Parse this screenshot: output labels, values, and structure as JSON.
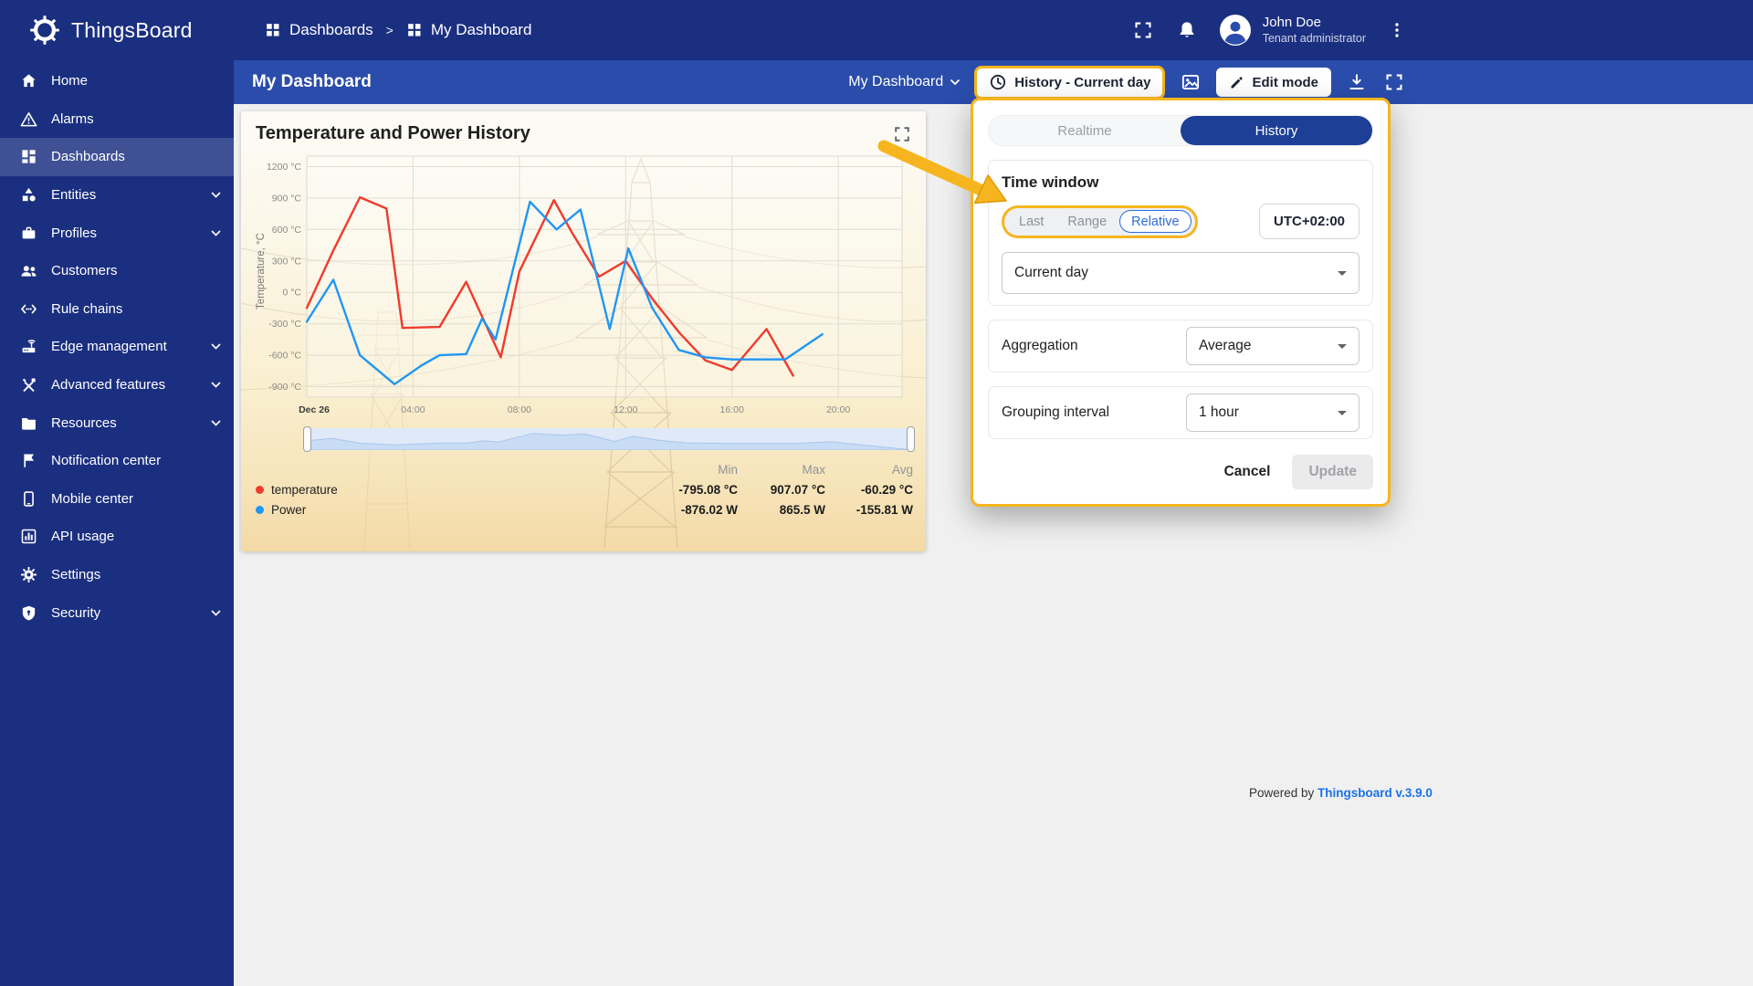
{
  "colors": {
    "header_blue": "#1b2f80",
    "toolbar_blue": "#2a4cab",
    "highlight_gold": "#f6b51e",
    "temperature_series": "#ef3b2d",
    "power_series": "#2196f3",
    "active_tab_blue": "#1d3f96",
    "link_blue": "#1a73e8"
  },
  "header": {
    "brand": "ThingsBoard",
    "breadcrumb": {
      "root": "Dashboards",
      "separator": ">",
      "current": "My Dashboard"
    },
    "user": {
      "name": "John Doe",
      "role": "Tenant administrator"
    }
  },
  "icons": {
    "logo": "gear-icon",
    "header": [
      "fullscreen-icon",
      "notifications-bell-icon",
      "avatar-icon",
      "kebab-menu-icon"
    ],
    "toolbar": [
      "chevron-down-icon",
      "clock-icon",
      "image-icon",
      "pencil-icon",
      "download-icon",
      "fullscreen-icon"
    ],
    "widget": [
      "expand-icon"
    ]
  },
  "sidebar": {
    "items": [
      {
        "label": "Home",
        "icon": "home-icon",
        "active": false,
        "expandable": false
      },
      {
        "label": "Alarms",
        "icon": "alarms-icon",
        "active": false,
        "expandable": false
      },
      {
        "label": "Dashboards",
        "icon": "dashboards-icon",
        "active": true,
        "expandable": false
      },
      {
        "label": "Entities",
        "icon": "entities-icon",
        "active": false,
        "expandable": true
      },
      {
        "label": "Profiles",
        "icon": "profiles-icon",
        "active": false,
        "expandable": true
      },
      {
        "label": "Customers",
        "icon": "customers-icon",
        "active": false,
        "expandable": false
      },
      {
        "label": "Rule chains",
        "icon": "rule-chains-icon",
        "active": false,
        "expandable": false
      },
      {
        "label": "Edge management",
        "icon": "edge-icon",
        "active": false,
        "expandable": true
      },
      {
        "label": "Advanced features",
        "icon": "advanced-icon",
        "active": false,
        "expandable": true
      },
      {
        "label": "Resources",
        "icon": "resources-icon",
        "active": false,
        "expandable": true
      },
      {
        "label": "Notification center",
        "icon": "notification-icon",
        "active": false,
        "expandable": false
      },
      {
        "label": "Mobile center",
        "icon": "mobile-icon",
        "active": false,
        "expandable": false
      },
      {
        "label": "API usage",
        "icon": "api-icon",
        "active": false,
        "expandable": false
      },
      {
        "label": "Settings",
        "icon": "settings-icon",
        "active": false,
        "expandable": false
      },
      {
        "label": "Security",
        "icon": "security-icon",
        "active": false,
        "expandable": true
      }
    ]
  },
  "toolbar": {
    "title": "My Dashboard",
    "dashboard_select": "My Dashboard",
    "timewindow_button": "History - Current day",
    "edit_button": "Edit mode"
  },
  "widget": {
    "title": "Temperature and Power History",
    "legend": {
      "headers": [
        "Min",
        "Max",
        "Avg"
      ],
      "rows": [
        {
          "name": "temperature",
          "color": "#ef3b2d",
          "min": "-795.08 °C",
          "max": "907.07 °C",
          "avg": "-60.29 °C"
        },
        {
          "name": "Power",
          "color": "#2196f3",
          "min": "-876.02 W",
          "max": "865.5 W",
          "avg": "-155.81 W"
        }
      ]
    }
  },
  "chart_data": {
    "type": "line",
    "title": "Temperature and Power History",
    "xlabel": "",
    "ylabel": "Temperature, °C",
    "ylim": [
      -1000,
      1300
    ],
    "y_ticks": [
      1200,
      900,
      600,
      300,
      0,
      -300,
      -600,
      -900
    ],
    "y_tick_suffix": " °C",
    "xlim": [
      0,
      22.4
    ],
    "x_ticks": [
      {
        "x": 0,
        "label": "Dec 26",
        "emph": true
      },
      {
        "x": 4,
        "label": "04:00",
        "emph": false
      },
      {
        "x": 8,
        "label": "08:00",
        "emph": false
      },
      {
        "x": 12,
        "label": "12:00",
        "emph": false
      },
      {
        "x": 16,
        "label": "16:00",
        "emph": false
      },
      {
        "x": 20,
        "label": "20:00",
        "emph": false
      }
    ],
    "grid": true,
    "legend_position": "bottom",
    "series": [
      {
        "name": "temperature",
        "unit": "°C",
        "color": "#ef3b2d",
        "points": [
          [
            0,
            -150
          ],
          [
            1,
            400
          ],
          [
            2,
            907.07
          ],
          [
            3,
            800
          ],
          [
            3.6,
            -340
          ],
          [
            5,
            -330
          ],
          [
            6,
            100
          ],
          [
            7.3,
            -620
          ],
          [
            8,
            200
          ],
          [
            9.3,
            880
          ],
          [
            10,
            560
          ],
          [
            11,
            150
          ],
          [
            12,
            300
          ],
          [
            13,
            -60
          ],
          [
            14,
            -380
          ],
          [
            15,
            -650
          ],
          [
            16,
            -740
          ],
          [
            17.3,
            -350
          ],
          [
            18.3,
            -795.08
          ]
        ]
      },
      {
        "name": "Power",
        "unit": "W",
        "color": "#2196f3",
        "points": [
          [
            0,
            -280
          ],
          [
            1,
            120
          ],
          [
            2,
            -600
          ],
          [
            3.3,
            -876.02
          ],
          [
            4.3,
            -700
          ],
          [
            5,
            -600
          ],
          [
            6,
            -590
          ],
          [
            6.6,
            -250
          ],
          [
            7.1,
            -450
          ],
          [
            8.4,
            865.5
          ],
          [
            9.4,
            600
          ],
          [
            10.3,
            790
          ],
          [
            11.4,
            -350
          ],
          [
            12.1,
            420
          ],
          [
            13,
            -150
          ],
          [
            14,
            -550
          ],
          [
            15,
            -620
          ],
          [
            16,
            -640
          ],
          [
            18,
            -640
          ],
          [
            19.4,
            -400
          ]
        ]
      }
    ],
    "stats": {
      "temperature": {
        "min": -795.08,
        "max": 907.07,
        "avg": -60.29
      },
      "Power": {
        "min": -876.02,
        "max": 865.5,
        "avg": -155.81
      }
    }
  },
  "popup": {
    "tabs": [
      {
        "label": "Realtime",
        "active": false
      },
      {
        "label": "History",
        "active": true
      }
    ],
    "time_window": {
      "title": "Time window",
      "modes": [
        "Last",
        "Range",
        "Relative"
      ],
      "selected_mode": "Relative",
      "timezone": "UTC+02:00",
      "interval": "Current day"
    },
    "aggregation": {
      "label": "Aggregation",
      "value": "Average"
    },
    "grouping": {
      "label": "Grouping interval",
      "value": "1 hour"
    },
    "actions": {
      "cancel": "Cancel",
      "update": "Update"
    }
  },
  "footer": {
    "powered_by": "Powered by",
    "version_link": "Thingsboard v.3.9.0"
  }
}
